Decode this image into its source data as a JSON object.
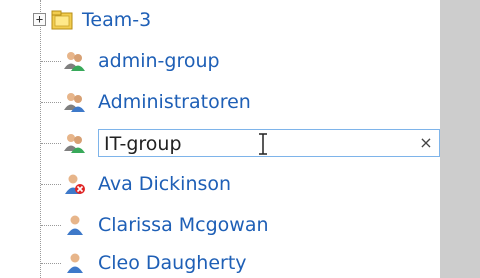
{
  "tree": {
    "team": {
      "label": "Team-3",
      "expander": "+",
      "icon": "folder-icon"
    },
    "items": [
      {
        "label": "admin-group",
        "icon": "group-icon"
      },
      {
        "label": "Administratoren",
        "icon": "group-icon"
      },
      {
        "label": "IT-group",
        "icon": "group-icon",
        "editing": true
      },
      {
        "label": "Ava Dickinson",
        "icon": "user-disabled-icon"
      },
      {
        "label": "Clarissa Mcgowan",
        "icon": "user-icon"
      },
      {
        "label": "Cleo Daugherty",
        "icon": "user-icon"
      }
    ]
  },
  "editor": {
    "value": "IT-group",
    "clear_label": "×"
  },
  "colors": {
    "link": "#1e5fb6",
    "scrollbar": "#cdcdcd",
    "edit_border": "#7eb4ea"
  }
}
